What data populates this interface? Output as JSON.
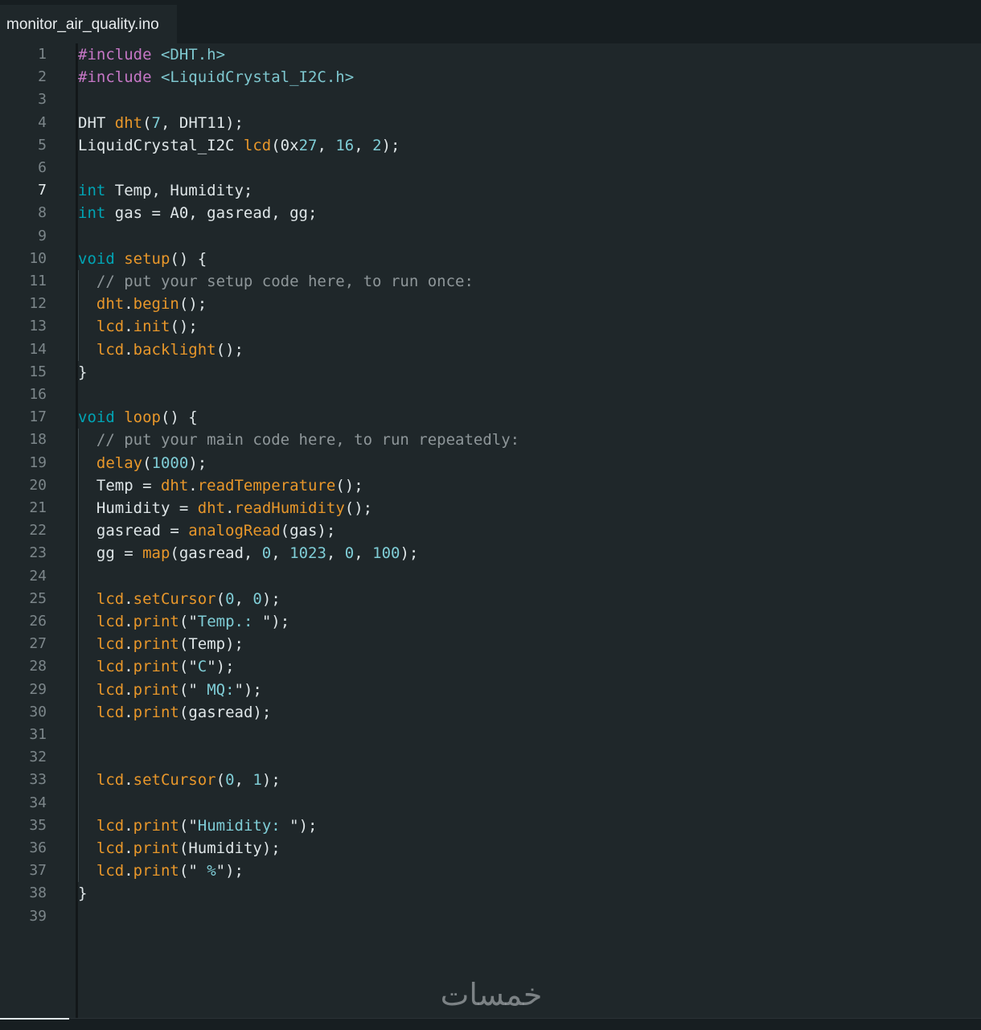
{
  "tab": {
    "filename": "monitor_air_quality.ino"
  },
  "editor": {
    "active_line": 7,
    "lines": [
      [
        [
          "dir",
          "#include "
        ],
        [
          "inc",
          "<DHT.h>"
        ]
      ],
      [
        [
          "dir",
          "#include "
        ],
        [
          "inc",
          "<LiquidCrystal_I2C.h>"
        ]
      ],
      [],
      [
        [
          "pl",
          "DHT "
        ],
        [
          "fn",
          "dht"
        ],
        [
          "pl",
          "("
        ],
        [
          "num",
          "7"
        ],
        [
          "pl",
          ", DHT11);"
        ]
      ],
      [
        [
          "pl",
          "LiquidCrystal_I2C "
        ],
        [
          "fn",
          "lcd"
        ],
        [
          "pl",
          "(0x"
        ],
        [
          "num",
          "27"
        ],
        [
          "pl",
          ", "
        ],
        [
          "num",
          "16"
        ],
        [
          "pl",
          ", "
        ],
        [
          "num",
          "2"
        ],
        [
          "pl",
          ");"
        ]
      ],
      [],
      [
        [
          "kw",
          "int"
        ],
        [
          "pl",
          " Temp, Humidity;"
        ]
      ],
      [
        [
          "kw",
          "int"
        ],
        [
          "pl",
          " gas = A0, gasread, gg;"
        ]
      ],
      [],
      [
        [
          "kw",
          "void"
        ],
        [
          "pl",
          " "
        ],
        [
          "fn",
          "setup"
        ],
        [
          "pl",
          "() {"
        ]
      ],
      [
        [
          "pl",
          "  "
        ],
        [
          "cmt",
          "// put your setup code here, to run once:"
        ]
      ],
      [
        [
          "pl",
          "  "
        ],
        [
          "fn",
          "dht"
        ],
        [
          "pl",
          "."
        ],
        [
          "fn",
          "begin"
        ],
        [
          "pl",
          "();"
        ]
      ],
      [
        [
          "pl",
          "  "
        ],
        [
          "fn",
          "lcd"
        ],
        [
          "pl",
          "."
        ],
        [
          "fn",
          "init"
        ],
        [
          "pl",
          "();"
        ]
      ],
      [
        [
          "pl",
          "  "
        ],
        [
          "fn",
          "lcd"
        ],
        [
          "pl",
          "."
        ],
        [
          "fn",
          "backlight"
        ],
        [
          "pl",
          "();"
        ]
      ],
      [
        [
          "pl",
          "}"
        ]
      ],
      [],
      [
        [
          "kw",
          "void"
        ],
        [
          "pl",
          " "
        ],
        [
          "fn",
          "loop"
        ],
        [
          "pl",
          "() {"
        ]
      ],
      [
        [
          "pl",
          "  "
        ],
        [
          "cmt",
          "// put your main code here, to run repeatedly:"
        ]
      ],
      [
        [
          "pl",
          "  "
        ],
        [
          "fn",
          "delay"
        ],
        [
          "pl",
          "("
        ],
        [
          "num",
          "1000"
        ],
        [
          "pl",
          ");"
        ]
      ],
      [
        [
          "pl",
          "  Temp = "
        ],
        [
          "fn",
          "dht"
        ],
        [
          "pl",
          "."
        ],
        [
          "fn",
          "readTemperature"
        ],
        [
          "pl",
          "();"
        ]
      ],
      [
        [
          "pl",
          "  Humidity = "
        ],
        [
          "fn",
          "dht"
        ],
        [
          "pl",
          "."
        ],
        [
          "fn",
          "readHumidity"
        ],
        [
          "pl",
          "();"
        ]
      ],
      [
        [
          "pl",
          "  gasread = "
        ],
        [
          "fn",
          "analogRead"
        ],
        [
          "pl",
          "(gas);"
        ]
      ],
      [
        [
          "pl",
          "  gg = "
        ],
        [
          "fn",
          "map"
        ],
        [
          "pl",
          "(gasread, "
        ],
        [
          "num",
          "0"
        ],
        [
          "pl",
          ", "
        ],
        [
          "num",
          "1023"
        ],
        [
          "pl",
          ", "
        ],
        [
          "num",
          "0"
        ],
        [
          "pl",
          ", "
        ],
        [
          "num",
          "100"
        ],
        [
          "pl",
          ");"
        ]
      ],
      [],
      [
        [
          "pl",
          "  "
        ],
        [
          "fn",
          "lcd"
        ],
        [
          "pl",
          "."
        ],
        [
          "fn",
          "setCursor"
        ],
        [
          "pl",
          "("
        ],
        [
          "num",
          "0"
        ],
        [
          "pl",
          ", "
        ],
        [
          "num",
          "0"
        ],
        [
          "pl",
          ");"
        ]
      ],
      [
        [
          "pl",
          "  "
        ],
        [
          "fn",
          "lcd"
        ],
        [
          "pl",
          "."
        ],
        [
          "fn",
          "print"
        ],
        [
          "pl",
          "(\""
        ],
        [
          "str",
          "Temp.: "
        ],
        [
          "pl",
          "\");"
        ]
      ],
      [
        [
          "pl",
          "  "
        ],
        [
          "fn",
          "lcd"
        ],
        [
          "pl",
          "."
        ],
        [
          "fn",
          "print"
        ],
        [
          "pl",
          "(Temp);"
        ]
      ],
      [
        [
          "pl",
          "  "
        ],
        [
          "fn",
          "lcd"
        ],
        [
          "pl",
          "."
        ],
        [
          "fn",
          "print"
        ],
        [
          "pl",
          "(\""
        ],
        [
          "str",
          "C"
        ],
        [
          "pl",
          "\");"
        ]
      ],
      [
        [
          "pl",
          "  "
        ],
        [
          "fn",
          "lcd"
        ],
        [
          "pl",
          "."
        ],
        [
          "fn",
          "print"
        ],
        [
          "pl",
          "(\""
        ],
        [
          "str",
          " MQ:"
        ],
        [
          "pl",
          "\");"
        ]
      ],
      [
        [
          "pl",
          "  "
        ],
        [
          "fn",
          "lcd"
        ],
        [
          "pl",
          "."
        ],
        [
          "fn",
          "print"
        ],
        [
          "pl",
          "(gasread);"
        ]
      ],
      [],
      [],
      [
        [
          "pl",
          "  "
        ],
        [
          "fn",
          "lcd"
        ],
        [
          "pl",
          "."
        ],
        [
          "fn",
          "setCursor"
        ],
        [
          "pl",
          "("
        ],
        [
          "num",
          "0"
        ],
        [
          "pl",
          ", "
        ],
        [
          "num",
          "1"
        ],
        [
          "pl",
          ");"
        ]
      ],
      [],
      [
        [
          "pl",
          "  "
        ],
        [
          "fn",
          "lcd"
        ],
        [
          "pl",
          "."
        ],
        [
          "fn",
          "print"
        ],
        [
          "pl",
          "(\""
        ],
        [
          "str",
          "Humidity: "
        ],
        [
          "pl",
          "\");"
        ]
      ],
      [
        [
          "pl",
          "  "
        ],
        [
          "fn",
          "lcd"
        ],
        [
          "pl",
          "."
        ],
        [
          "fn",
          "print"
        ],
        [
          "pl",
          "(Humidity);"
        ]
      ],
      [
        [
          "pl",
          "  "
        ],
        [
          "fn",
          "lcd"
        ],
        [
          "pl",
          "."
        ],
        [
          "fn",
          "print"
        ],
        [
          "pl",
          "(\""
        ],
        [
          "str",
          " %"
        ],
        [
          "pl",
          "\");"
        ]
      ],
      [
        [
          "pl",
          "}"
        ]
      ],
      []
    ]
  },
  "watermark": {
    "text": "خمسات"
  }
}
